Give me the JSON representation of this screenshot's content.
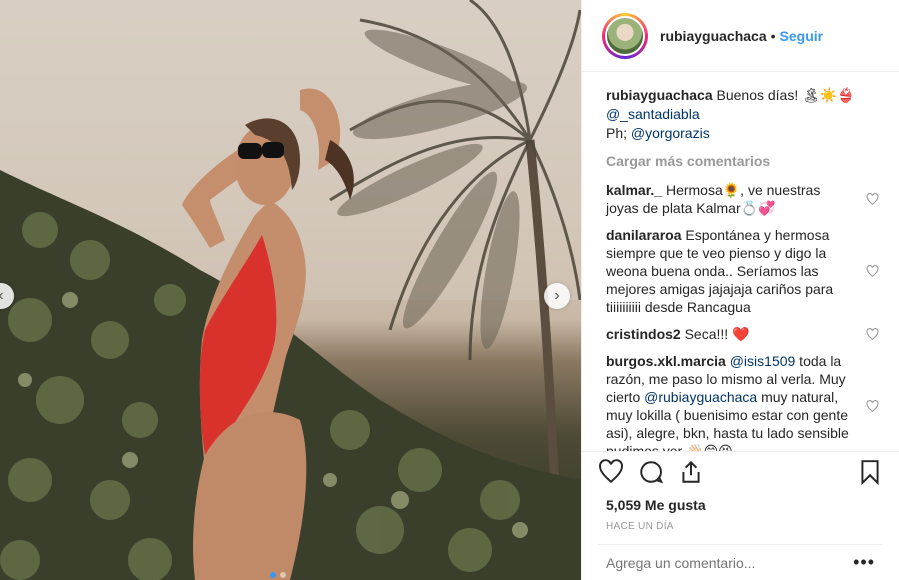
{
  "post": {
    "username": "rubiayguachaca",
    "separator": "•",
    "follow_label": "Seguir",
    "caption_user": "rubiayguachaca",
    "caption_text": "Buenos días! 🏝☀️👙",
    "caption_mention": "@_santadiabla",
    "caption_credit_prefix": "Ph; ",
    "caption_credit_mention": "@yorgorazis",
    "load_more_label": "Cargar más comentarios",
    "likes": "5,059 Me gusta",
    "time": "HACE UN DÍA",
    "comment_placeholder": "Agrega un comentario...",
    "more_label": "•••"
  },
  "comments": [
    {
      "user": "kalmar._",
      "text": "Hermosa🌻, ve nuestras joyas de plata Kalmar💍💞"
    },
    {
      "user": "danilararoa",
      "text": "Espontánea y hermosa siempre que te veo pienso y digo la weona buena onda.. Seríamos las mejores amigas jajajaja cariños para tiiiiiiiiii desde Rancagua"
    },
    {
      "user": "cristindos2",
      "text": "Seca!!! ❤️"
    },
    {
      "user": "burgos.xkl.marcia",
      "mention1": "@isis1509",
      "text1": " toda la razón, me paso lo mismo al verla. Muy cierto ",
      "mention2": "@rubiayguachaca",
      "text2": " muy natural, muy lokilla ( buenisimo estar con gente asi), alegre, bkn, hasta tu lado sensible pudimos ver 👋🏻😊😆"
    }
  ],
  "icons": {
    "heart": "heart-icon",
    "comment": "comment-icon",
    "share": "share-icon",
    "save": "bookmark-icon",
    "prev": "chevron-left-icon",
    "next": "chevron-right-icon"
  },
  "colors": {
    "accent": "#3897f0",
    "mention": "#003569",
    "muted": "#999999",
    "swimsuit": "#d9322c"
  },
  "carousel": {
    "dots": 2,
    "active": 0
  }
}
